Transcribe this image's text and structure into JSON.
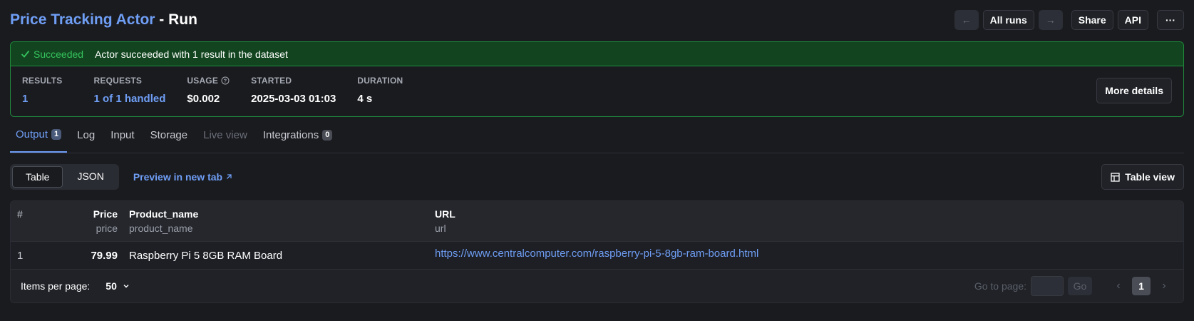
{
  "header": {
    "actor_title": "Price Tracking Actor",
    "run_suffix": " - Run",
    "all_runs": "All runs",
    "share": "Share",
    "api": "API",
    "more": "···"
  },
  "status": {
    "state": "Succeeded",
    "message": "Actor succeeded with 1 result in the dataset",
    "accent_color": "#35c25e",
    "stats": [
      {
        "label": "RESULTS",
        "value": "1"
      },
      {
        "label": "REQUESTS",
        "value": "1 of 1 handled"
      },
      {
        "label": "USAGE",
        "value": "$0.002"
      },
      {
        "label": "STARTED",
        "value": "2025-03-03 01:03"
      },
      {
        "label": "DURATION",
        "value": "4 s"
      }
    ],
    "more_details": "More details"
  },
  "tabs": [
    {
      "label": "Output",
      "badge": "1"
    },
    {
      "label": "Log"
    },
    {
      "label": "Input"
    },
    {
      "label": "Storage"
    },
    {
      "label": "Live view"
    },
    {
      "label": "Integrations",
      "badge": "0"
    }
  ],
  "toolbar": {
    "view_table": "Table",
    "view_json": "JSON",
    "preview": "Preview in new tab",
    "table_view": "Table view"
  },
  "table": {
    "columns": [
      {
        "title": "#",
        "sub": ""
      },
      {
        "title": "Price",
        "sub": "price"
      },
      {
        "title": "Product_name",
        "sub": "product_name"
      },
      {
        "title": "URL",
        "sub": "url"
      }
    ],
    "rows": [
      {
        "idx": "1",
        "price": "79.99",
        "name": "Raspberry Pi 5 8GB RAM Board",
        "url": "https://www.centralcomputer.com/raspberry-pi-5-8gb-ram-board.html"
      }
    ]
  },
  "pager": {
    "items_per_page_label": "Items per page:",
    "items_per_page": "50",
    "goto_label": "Go to page:",
    "go": "Go",
    "current_page": "1"
  }
}
